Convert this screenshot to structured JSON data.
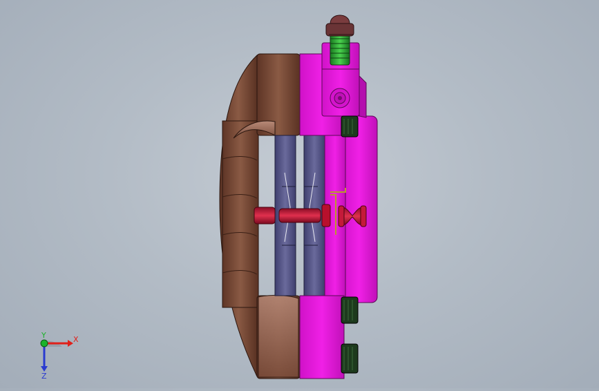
{
  "viewport": {
    "background_top": "#c4cbd3",
    "background_bottom": "#a3adb9"
  },
  "model": {
    "parts": [
      {
        "name": "caliper-body-outer",
        "color": "#7a4a36"
      },
      {
        "name": "caliper-body-inner",
        "color": "#e81adf"
      },
      {
        "name": "brake-pad",
        "color": "#5a5a8c"
      },
      {
        "name": "piston-pin",
        "color": "#c41a3a"
      },
      {
        "name": "bleed-fitting",
        "color": "#2fa83a"
      },
      {
        "name": "bleed-cap",
        "color": "#6a3436"
      },
      {
        "name": "mount-bolt",
        "color": "#1d3a1d"
      }
    ]
  },
  "triad": {
    "x_label": "X",
    "y_label": "Y",
    "z_label": "Z",
    "x_color": "#e0201a",
    "y_color": "#1bb32a",
    "z_color": "#2a3ad0"
  }
}
